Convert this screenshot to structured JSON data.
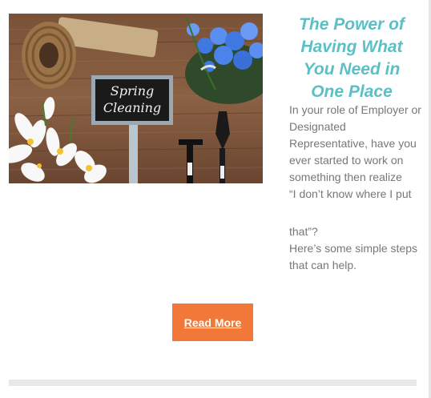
{
  "article": {
    "title": "The Power of Having What You Need in One Place",
    "body_lines": [
      "In your role of Employer or Designated Representative, have you ever started to work on something then realize",
      "“I don’t know where I put",
      "that”?",
      "Here’s some simple steps that can help."
    ],
    "sign_text_line1": "Spring",
    "sign_text_line2": "Cleaning",
    "button_label": "Read More"
  },
  "colors": {
    "title": "#5bc0c6",
    "body_text": "#777777",
    "button_bg": "#f2783a",
    "button_text": "#ffffff"
  },
  "icons": [
    "twine-spool-icon",
    "blue-flowers-icon",
    "white-flowers-icon",
    "garden-tools-icon"
  ]
}
